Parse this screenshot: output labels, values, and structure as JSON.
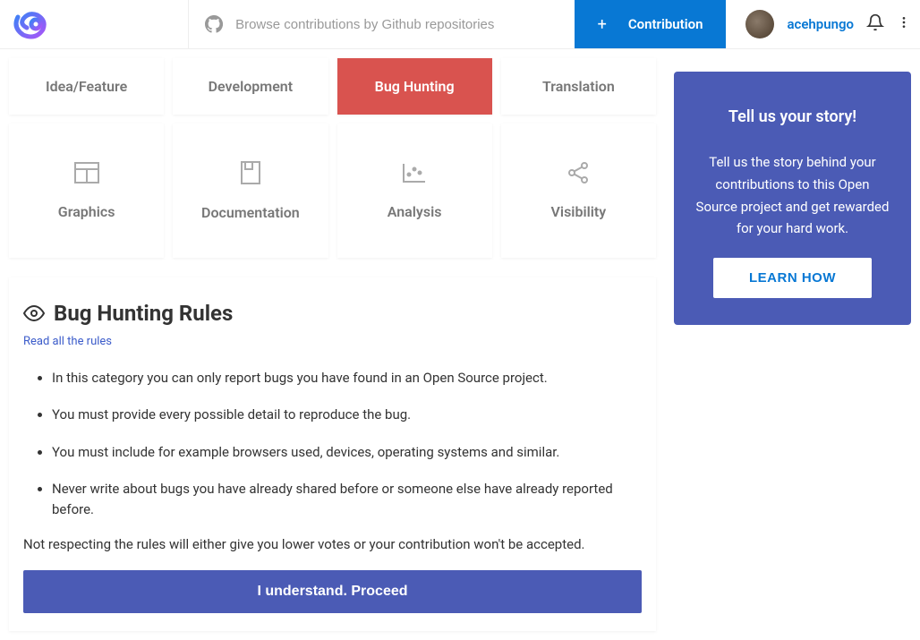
{
  "header": {
    "search_placeholder": "Browse contributions by Github repositories",
    "contribution_label": "Contribution",
    "username": "acehpungo"
  },
  "categories": {
    "row1": [
      {
        "label": "Idea/Feature"
      },
      {
        "label": "Development"
      },
      {
        "label": "Bug Hunting",
        "active": true
      },
      {
        "label": "Translation"
      }
    ],
    "row2": [
      {
        "label": "Graphics",
        "icon": "window"
      },
      {
        "label": "Documentation",
        "icon": "book"
      },
      {
        "label": "Analysis",
        "icon": "chart"
      },
      {
        "label": "Visibility",
        "icon": "share"
      }
    ]
  },
  "rules": {
    "title": "Bug Hunting Rules",
    "read_all": "Read all the rules",
    "items": [
      "In this category you can only report bugs you have found in an Open Source project.",
      "You must provide every possible detail to reproduce the bug.",
      "You must include for example browsers used, devices, operating systems and similar.",
      "Never write about bugs you have already shared before or someone else have already reported before."
    ],
    "warning": "Not respecting the rules will either give you lower votes or your contribution won't be accepted.",
    "proceed": "I understand. Proceed"
  },
  "story": {
    "title": "Tell us your story!",
    "text": "Tell us the story behind your contributions to this Open Source project and get rewarded for your hard work.",
    "button": "LEARN HOW"
  }
}
